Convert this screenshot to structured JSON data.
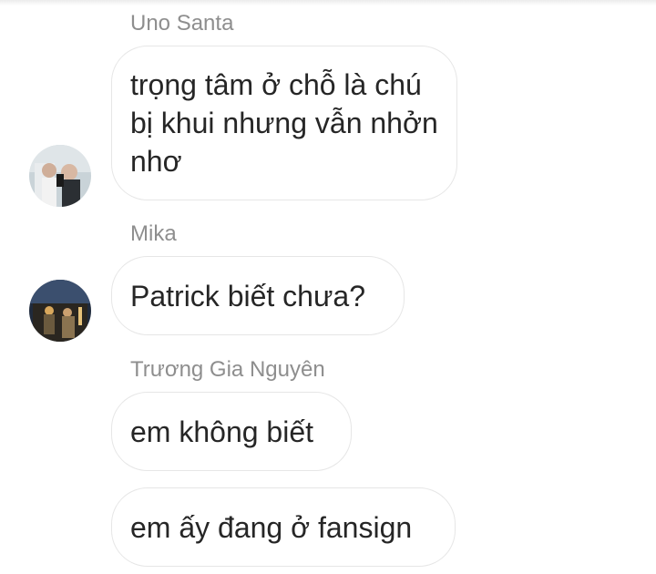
{
  "conversation": {
    "groups": [
      {
        "sender": "Uno Santa",
        "avatar_icon": "user-avatar-photo",
        "messages": [
          "trọng tâm ở chỗ là chú bị khui nhưng vẫn nhởn nhơ"
        ]
      },
      {
        "sender": "Mika",
        "avatar_icon": "user-avatar-photo",
        "messages": [
          "Patrick biết chưa?"
        ]
      },
      {
        "sender": "Trương Gia Nguyên",
        "messages": [
          "em không biết",
          "em ấy đang ở fansign"
        ]
      }
    ]
  }
}
